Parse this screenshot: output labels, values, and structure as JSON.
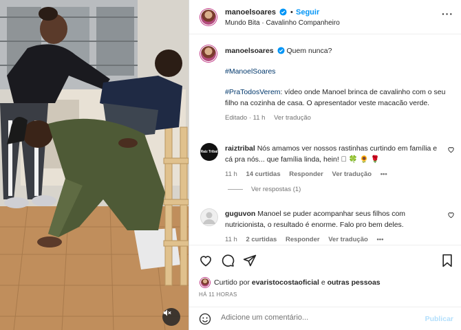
{
  "post": {
    "username": "manoelsoares",
    "follow_label": "Seguir",
    "separator": "•",
    "audio": "Mundo Bita · Cavalinho Companheiro",
    "more": "···"
  },
  "caption": {
    "username": "manoelsoares",
    "text": "Quem nunca?",
    "hashtag": "#ManoelSoares",
    "ptv_tag": "#PraTodosVerem",
    "ptv_text": ": vídeo onde Manoel brinca de cavalinho com o seu filho na cozinha de casa. O apresentador veste macacão verde.",
    "edited": "Editado · 11 h",
    "translate": "Ver tradução"
  },
  "comments": [
    {
      "username": "raiztribal",
      "avatar_text": "Raiz Tribal",
      "text": "Nós amamos ver nossos rastinhas curtindo em família e cá pra nós... que família linda, hein! 🏻 🍀 🌻 🌹",
      "time": "11 h",
      "likes": "14 curtidas",
      "reply": "Responder",
      "translate": "Ver tradução",
      "more": "•••",
      "view_replies": "Ver respostas (1)"
    },
    {
      "username": "guguvon",
      "text": "Manoel se puder acompanhar seus filhos com nutricionista, o resultado é enorme. Falo pro bem deles.",
      "time": "11 h",
      "likes": "2 curtidas",
      "reply": "Responder",
      "translate": "Ver tradução",
      "more": "•••"
    }
  ],
  "liked_by": {
    "prefix": "Curtido por ",
    "user": "evaristocostaoficial",
    "middle": " e ",
    "others": "outras pessoas"
  },
  "timestamp": "HÁ 11 HORAS",
  "add_comment": {
    "placeholder": "Adicione um comentário...",
    "publish_label": "Publicar"
  },
  "icons": [
    "verified-icon",
    "heart-icon",
    "comment-icon",
    "share-icon",
    "bookmark-icon",
    "emoji-icon",
    "mute-icon"
  ],
  "colors": {
    "link": "#0095f6",
    "hashtag": "#00376b",
    "publish_disabled": "#b2dffc",
    "muted_text": "#737373"
  }
}
